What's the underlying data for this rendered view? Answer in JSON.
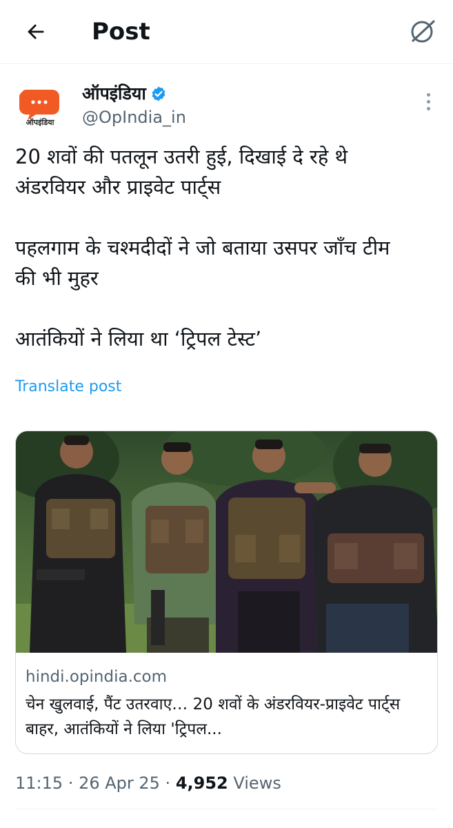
{
  "header": {
    "title": "Post",
    "back_icon": "arrow-left-icon",
    "grok_icon": "grok-icon"
  },
  "author": {
    "name": "ऑपइंडिया",
    "handle": "@OpIndia_in",
    "avatar_text": "ऑपइंडिया",
    "avatar_color": "#f15a24",
    "verified_color": "#1d9bf0"
  },
  "post": {
    "lines": [
      "20 शवों की पतलून उतरी हुई, दिखाई दे रहे थे",
      "अंडरवियर और प्राइवेट पार्ट्स",
      "पहलगाम के चश्मदीदों ने जो बताया उसपर जाँच टीम",
      "की भी मुहर",
      "आतंकियों ने लिया था ‘ट्रिपल टेस्ट’"
    ],
    "translate_label": "Translate post"
  },
  "card": {
    "domain": "hindi.opindia.com",
    "title": "चेन खुलवाई, पैंट उतरवाए… 20 शवों के अंडरवियर-प्राइवेट पार्ट्स बाहर, आतंकियों ने लिया 'ट्रिपल..."
  },
  "meta": {
    "time": "11:15",
    "separator": " · ",
    "date": "26 Apr 25",
    "views_count": "4,952",
    "views_label": " Views"
  },
  "colors": {
    "accent": "#1d9bf0",
    "muted": "#536471",
    "text": "#0f1419"
  }
}
